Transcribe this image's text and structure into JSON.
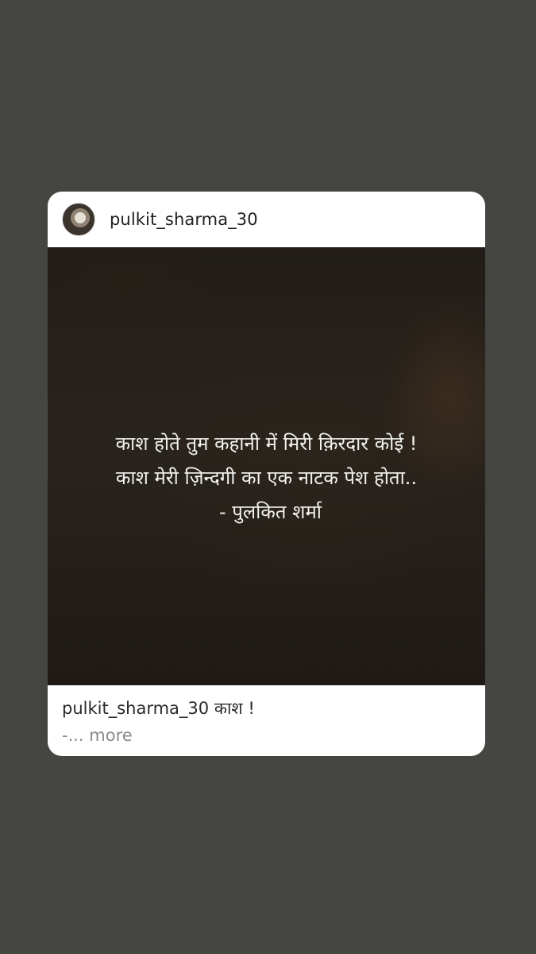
{
  "post": {
    "username": "pulkit_sharma_30",
    "quote_lines": [
      "काश होते तुम कहानी में मिरी क़िरदार कोई !",
      "काश मेरी ज़िन्दगी का एक नाटक पेश होता..",
      "- पुलकित शर्मा"
    ],
    "caption_username": "pulkit_sharma_30",
    "caption_text": "काश !",
    "more_prefix": "-...",
    "more_label": "more"
  },
  "icons": {
    "avatar": "profile-avatar"
  }
}
